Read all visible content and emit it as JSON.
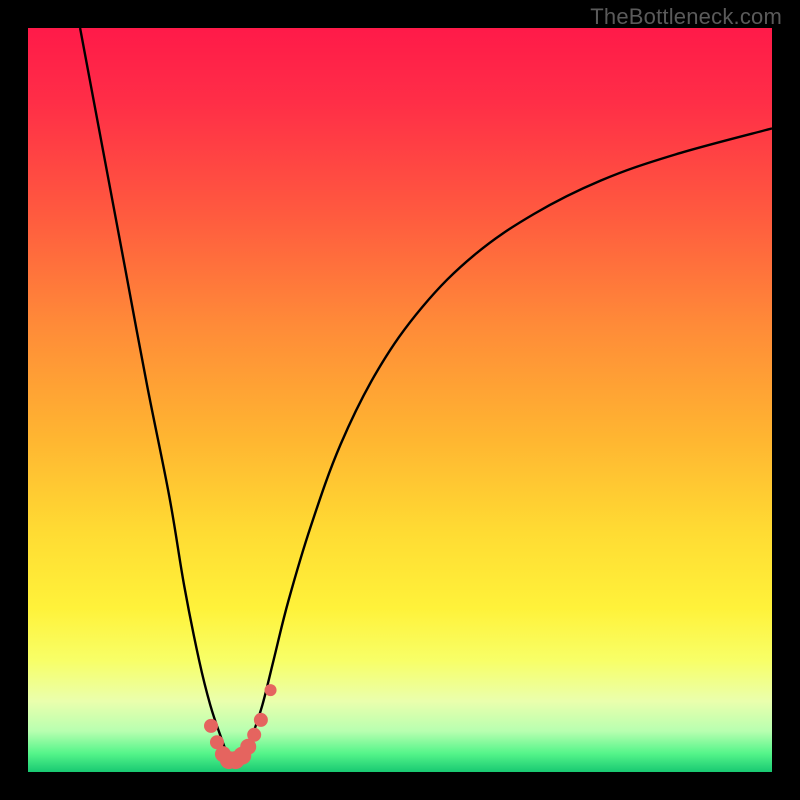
{
  "watermark": "TheBottleneck.com",
  "colors": {
    "frame": "#000000",
    "curve": "#000000",
    "marker_fill": "#e5645f",
    "marker_stroke": "#d24c47",
    "gradient_stops": [
      {
        "offset": 0.0,
        "color": "#ff1a49"
      },
      {
        "offset": 0.1,
        "color": "#ff2e47"
      },
      {
        "offset": 0.25,
        "color": "#ff5a3f"
      },
      {
        "offset": 0.4,
        "color": "#ff8b38"
      },
      {
        "offset": 0.55,
        "color": "#ffb531"
      },
      {
        "offset": 0.68,
        "color": "#ffdc33"
      },
      {
        "offset": 0.78,
        "color": "#fff23a"
      },
      {
        "offset": 0.85,
        "color": "#f8ff67"
      },
      {
        "offset": 0.905,
        "color": "#eaffad"
      },
      {
        "offset": 0.945,
        "color": "#b8ffb0"
      },
      {
        "offset": 0.975,
        "color": "#55f58a"
      },
      {
        "offset": 1.0,
        "color": "#18c972"
      }
    ]
  },
  "chart_data": {
    "type": "line",
    "title": "",
    "xlabel": "",
    "ylabel": "",
    "xlim": [
      0,
      100
    ],
    "ylim": [
      0,
      100
    ],
    "series": [
      {
        "name": "bottleneck-curve",
        "x": [
          7,
          10,
          13,
          16,
          19,
          21,
          23,
          24.5,
          26,
          27,
          28,
          29,
          30,
          31.5,
          33,
          35,
          38,
          42,
          47,
          53,
          60,
          68,
          77,
          87,
          100
        ],
        "y": [
          100,
          84,
          68,
          52,
          37,
          25,
          15,
          9,
          4.5,
          2,
          1,
          2,
          4.5,
          9,
          15,
          23,
          33,
          44,
          54,
          62.5,
          69.5,
          75,
          79.5,
          83,
          86.5
        ]
      }
    ],
    "markers": {
      "name": "highlight-points",
      "x": [
        24.6,
        25.4,
        26.2,
        27.0,
        27.9,
        28.8,
        29.6,
        30.4,
        31.3,
        32.6
      ],
      "y": [
        6.2,
        4.0,
        2.4,
        1.6,
        1.6,
        2.2,
        3.4,
        5.0,
        7.0,
        11.0
      ],
      "r": [
        7,
        7,
        8,
        9,
        9,
        9,
        8,
        7,
        7,
        6
      ]
    }
  }
}
